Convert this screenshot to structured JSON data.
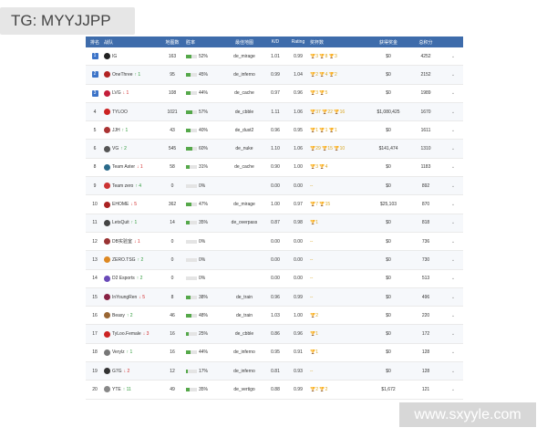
{
  "watermark_top": "TG: MYYJJPP",
  "watermark_bottom": "www.sxyyle.com",
  "headers": [
    "排名",
    "战队",
    "地图数",
    "胜率",
    "最佳地图",
    "K/D",
    "Rating",
    "奖杯数",
    "获得奖金",
    "总积分"
  ],
  "rows": [
    {
      "rank": "1",
      "badge": true,
      "team": "IG",
      "move_dir": "",
      "move": "",
      "maps": "163",
      "win_rate": "52%",
      "wr": 0.52,
      "best_map": "de_mirage",
      "kd": "1.01",
      "rating": "0.99",
      "trophies": "🏆3 🏆8 🏆3",
      "prize": "$0",
      "points": "4252",
      "logo_color": "#222222"
    },
    {
      "rank": "2",
      "badge": true,
      "team": "OneThree",
      "move_dir": "up",
      "move": "↑ 1",
      "maps": "95",
      "win_rate": "45%",
      "wr": 0.45,
      "best_map": "de_inferno",
      "kd": "0.99",
      "rating": "1.04",
      "trophies": "🏆2 🏆4 🏆2",
      "prize": "$0",
      "points": "2152",
      "logo_color": "#b22222"
    },
    {
      "rank": "3",
      "badge": true,
      "team": "LVG",
      "move_dir": "dn",
      "move": "↓ 1",
      "maps": "108",
      "win_rate": "44%",
      "wr": 0.44,
      "best_map": "de_cache",
      "kd": "0.97",
      "rating": "0.96",
      "trophies": "🏆3 🏆5",
      "prize": "$0",
      "points": "1989",
      "logo_color": "#c41e3a"
    },
    {
      "rank": "4",
      "badge": false,
      "team": "TYLOO",
      "move_dir": "",
      "move": "",
      "maps": "1021",
      "win_rate": "57%",
      "wr": 0.57,
      "best_map": "de_cbble",
      "kd": "1.11",
      "rating": "1.06",
      "trophies": "🏆37 🏆22 🏆16",
      "prize": "$1,080,425",
      "points": "1670",
      "logo_color": "#cc2222"
    },
    {
      "rank": "5",
      "badge": false,
      "team": "JJH",
      "move_dir": "up",
      "move": "↑ 1",
      "maps": "43",
      "win_rate": "40%",
      "wr": 0.4,
      "best_map": "de_dust2",
      "kd": "0.96",
      "rating": "0.95",
      "trophies": "🏆1 🏆1 🏆1",
      "prize": "$0",
      "points": "1611",
      "logo_color": "#aa3333"
    },
    {
      "rank": "6",
      "badge": false,
      "team": "VG",
      "move_dir": "up",
      "move": "↑ 2",
      "maps": "545",
      "win_rate": "60%",
      "wr": 0.6,
      "best_map": "de_nuke",
      "kd": "1.10",
      "rating": "1.06",
      "trophies": "🏆29 🏆15 🏆10",
      "prize": "$141,474",
      "points": "1310",
      "logo_color": "#555555"
    },
    {
      "rank": "8",
      "badge": false,
      "team": "Team Aster",
      "move_dir": "dn",
      "move": "↓ 1",
      "maps": "58",
      "win_rate": "31%",
      "wr": 0.31,
      "best_map": "de_cache",
      "kd": "0.90",
      "rating": "1.00",
      "trophies": "🏆3 🏆4",
      "prize": "$0",
      "points": "1183",
      "logo_color": "#2a6a8a"
    },
    {
      "rank": "9",
      "badge": false,
      "team": "Team zero",
      "move_dir": "up",
      "move": "↑ 4",
      "maps": "0",
      "win_rate": "0%",
      "wr": 0.0,
      "best_map": "",
      "kd": "0.00",
      "rating": "0.00",
      "trophies": "--",
      "prize": "$0",
      "points": "892",
      "logo_color": "#cc3333"
    },
    {
      "rank": "10",
      "badge": false,
      "team": "EHOME",
      "move_dir": "dn",
      "move": "↓ 5",
      "maps": "362",
      "win_rate": "47%",
      "wr": 0.47,
      "best_map": "de_mirage",
      "kd": "1.00",
      "rating": "0.97",
      "trophies": "🏆7 🏆15",
      "prize": "$25,103",
      "points": "870",
      "logo_color": "#aa2222"
    },
    {
      "rank": "11",
      "badge": false,
      "team": "LetsQuit",
      "move_dir": "up",
      "move": "↑ 1",
      "maps": "14",
      "win_rate": "35%",
      "wr": 0.35,
      "best_map": "de_overpass",
      "kd": "0.87",
      "rating": "0.98",
      "trophies": "🏆1",
      "prize": "$0",
      "points": "818",
      "logo_color": "#444444"
    },
    {
      "rank": "12",
      "badge": false,
      "team": "DB实验室",
      "move_dir": "dn",
      "move": "↓ 1",
      "maps": "0",
      "win_rate": "0%",
      "wr": 0.0,
      "best_map": "",
      "kd": "0.00",
      "rating": "0.00",
      "trophies": "--",
      "prize": "$0",
      "points": "736",
      "logo_color": "#993333"
    },
    {
      "rank": "13",
      "badge": false,
      "team": "ZERO.TSG",
      "move_dir": "up",
      "move": "↑ 2",
      "maps": "0",
      "win_rate": "0%",
      "wr": 0.0,
      "best_map": "",
      "kd": "0.00",
      "rating": "0.00",
      "trophies": "--",
      "prize": "$0",
      "points": "730",
      "logo_color": "#dd8822"
    },
    {
      "rank": "14",
      "badge": false,
      "team": "D2 Esports",
      "move_dir": "up",
      "move": "↑ 2",
      "maps": "0",
      "win_rate": "0%",
      "wr": 0.0,
      "best_map": "",
      "kd": "0.00",
      "rating": "0.00",
      "trophies": "--",
      "prize": "$0",
      "points": "513",
      "logo_color": "#6a4ab8"
    },
    {
      "rank": "15",
      "badge": false,
      "team": "InYoungRen",
      "move_dir": "dn",
      "move": "↓ 5",
      "maps": "8",
      "win_rate": "38%",
      "wr": 0.38,
      "best_map": "de_train",
      "kd": "0.96",
      "rating": "0.99",
      "trophies": "--",
      "prize": "$0",
      "points": "496",
      "logo_color": "#882244"
    },
    {
      "rank": "16",
      "badge": false,
      "team": "Beasy",
      "move_dir": "up",
      "move": "↑ 2",
      "maps": "46",
      "win_rate": "48%",
      "wr": 0.48,
      "best_map": "de_train",
      "kd": "1.03",
      "rating": "1.00",
      "trophies": "🏆2",
      "prize": "$0",
      "points": "220",
      "logo_color": "#996633"
    },
    {
      "rank": "17",
      "badge": false,
      "team": "TyLoo.Female",
      "move_dir": "dn",
      "move": "↓ 3",
      "maps": "16",
      "win_rate": "25%",
      "wr": 0.25,
      "best_map": "de_cbble",
      "kd": "0.86",
      "rating": "0.96",
      "trophies": "🏆1",
      "prize": "$0",
      "points": "172",
      "logo_color": "#cc2222"
    },
    {
      "rank": "18",
      "badge": false,
      "team": "Verylz",
      "move_dir": "up",
      "move": "↑ 1",
      "maps": "16",
      "win_rate": "44%",
      "wr": 0.44,
      "best_map": "de_inferno",
      "kd": "0.95",
      "rating": "0.91",
      "trophies": "🏆1",
      "prize": "$0",
      "points": "128",
      "logo_color": "#777777"
    },
    {
      "rank": "19",
      "badge": false,
      "team": "G7G",
      "move_dir": "dn",
      "move": "↓ 2",
      "maps": "12",
      "win_rate": "17%",
      "wr": 0.17,
      "best_map": "de_inferno",
      "kd": "0.81",
      "rating": "0.93",
      "trophies": "--",
      "prize": "$0",
      "points": "128",
      "logo_color": "#333333"
    },
    {
      "rank": "20",
      "badge": false,
      "team": "YTE",
      "move_dir": "up",
      "move": "↑ 11",
      "maps": "49",
      "win_rate": "35%",
      "wr": 0.35,
      "best_map": "de_vertigo",
      "kd": "0.88",
      "rating": "0.99",
      "trophies": "🏆2 🏆2",
      "prize": "$1,672",
      "points": "121",
      "logo_color": "#888888"
    }
  ]
}
